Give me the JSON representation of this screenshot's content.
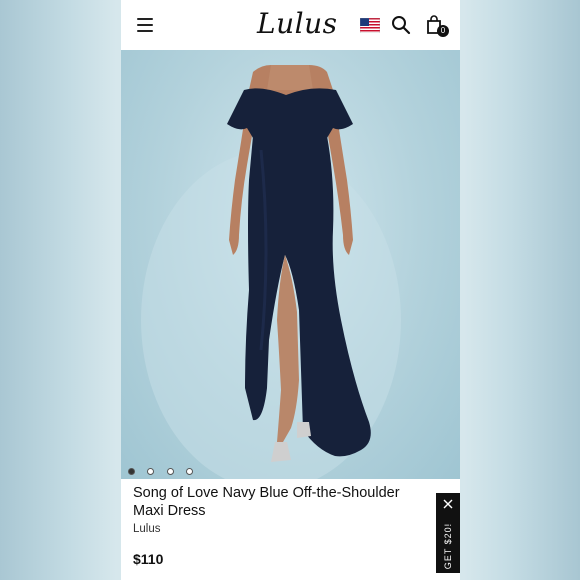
{
  "header": {
    "logo": "Lulus",
    "menu_icon": "hamburger-menu-icon",
    "flag_icon": "us-flag-icon",
    "search_icon": "search-icon",
    "cart_icon": "shopping-bag-icon",
    "cart_count": "0"
  },
  "gallery": {
    "image_description_icon": "dress-photo",
    "dots": [
      "1",
      "2",
      "3",
      "4"
    ],
    "active_index": 0
  },
  "product": {
    "title": "Song of Love Navy Blue Off-the-Shoulder Maxi Dress",
    "brand": "Lulus",
    "price": "$110"
  },
  "promo": {
    "label": "GET $20!",
    "close_icon": "close-icon"
  },
  "colors": {
    "dress": "#16213a",
    "background": "#a9c7d3",
    "promo_bg": "#111111"
  }
}
